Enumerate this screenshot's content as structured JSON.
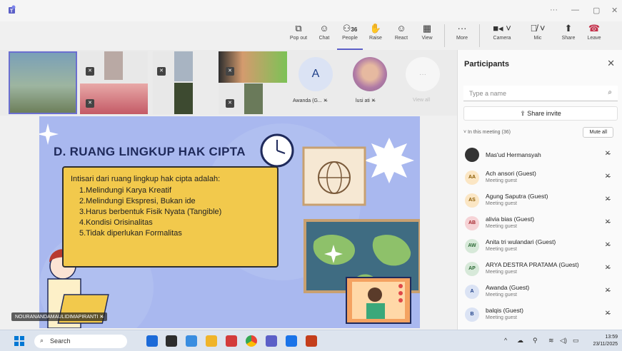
{
  "window": {
    "minimize": "—",
    "restore": "▢",
    "close": "✕",
    "more": "···"
  },
  "toolbar": {
    "popout": "Pop out",
    "chat": "Chat",
    "people": "People",
    "people_count": "36",
    "raise": "Raise",
    "react": "React",
    "view": "View",
    "more": "More",
    "camera": "Camera",
    "mic": "Mic",
    "share": "Share",
    "leave": "Leave"
  },
  "gallery": {
    "named_tiles": [
      {
        "initial": "A",
        "name": "Awanda (G...",
        "avatar_color": "#dbe3f4",
        "text_color": "#1d3f88"
      },
      {
        "name": "lusi ati"
      }
    ],
    "view_all": "View all"
  },
  "slide": {
    "title": "D. RUANG LINGKUP HAK CIPTA",
    "intro": "Intisari dari ruang lingkup hak cipta adalah:",
    "items": [
      "1.Melindungi Karya Kreatif",
      "2.Melindungi Ekspresi, Bukan ide",
      "3.Harus berbentuk Fisik Nyata (Tangible)",
      "4.Kondisi Orisinalitas",
      "5.Tidak diperlukan Formalitas"
    ],
    "presenter_tag": "NOURANANDAMAULIDIMAPIRANTI"
  },
  "participants_panel": {
    "title": "Participants",
    "search_placeholder": "Type a name",
    "share_invite": "Share invite",
    "section": "In this meeting (36)",
    "mute_all": "Mute all",
    "participants": [
      {
        "name": "Mas'ud Hermansyah",
        "role": "",
        "initials": "",
        "avatar_color": "#333333",
        "text_color": "#ffffff"
      },
      {
        "name": "Ach ansori (Guest)",
        "role": "Meeting guest",
        "initials": "AA",
        "avatar_color": "#fbe6c4",
        "text_color": "#8a5a00"
      },
      {
        "name": "Agung Saputra (Guest)",
        "role": "Meeting guest",
        "initials": "AS",
        "avatar_color": "#fbe6c4",
        "text_color": "#8a5a00"
      },
      {
        "name": "alivia bias (Guest)",
        "role": "Meeting guest",
        "initials": "AB",
        "avatar_color": "#f6d3d6",
        "text_color": "#a4262c"
      },
      {
        "name": "Anita tri wulandari (Guest)",
        "role": "Meeting guest",
        "initials": "AW",
        "avatar_color": "#d7e9d9",
        "text_color": "#2d6a36"
      },
      {
        "name": "ARYA DESTRA PRATAMA (Guest)",
        "role": "Meeting guest",
        "initials": "AP",
        "avatar_color": "#d7e9d9",
        "text_color": "#2d6a36"
      },
      {
        "name": "Awanda (Guest)",
        "role": "Meeting guest",
        "initials": "A",
        "avatar_color": "#dbe3f4",
        "text_color": "#1d3f88"
      },
      {
        "name": "balqis (Guest)",
        "role": "Meeting guest",
        "initials": "B",
        "avatar_color": "#dbe3f4",
        "text_color": "#1d3f88"
      }
    ]
  },
  "taskbar": {
    "search": "Search",
    "time": "13:59",
    "date": "23/11/2025"
  }
}
